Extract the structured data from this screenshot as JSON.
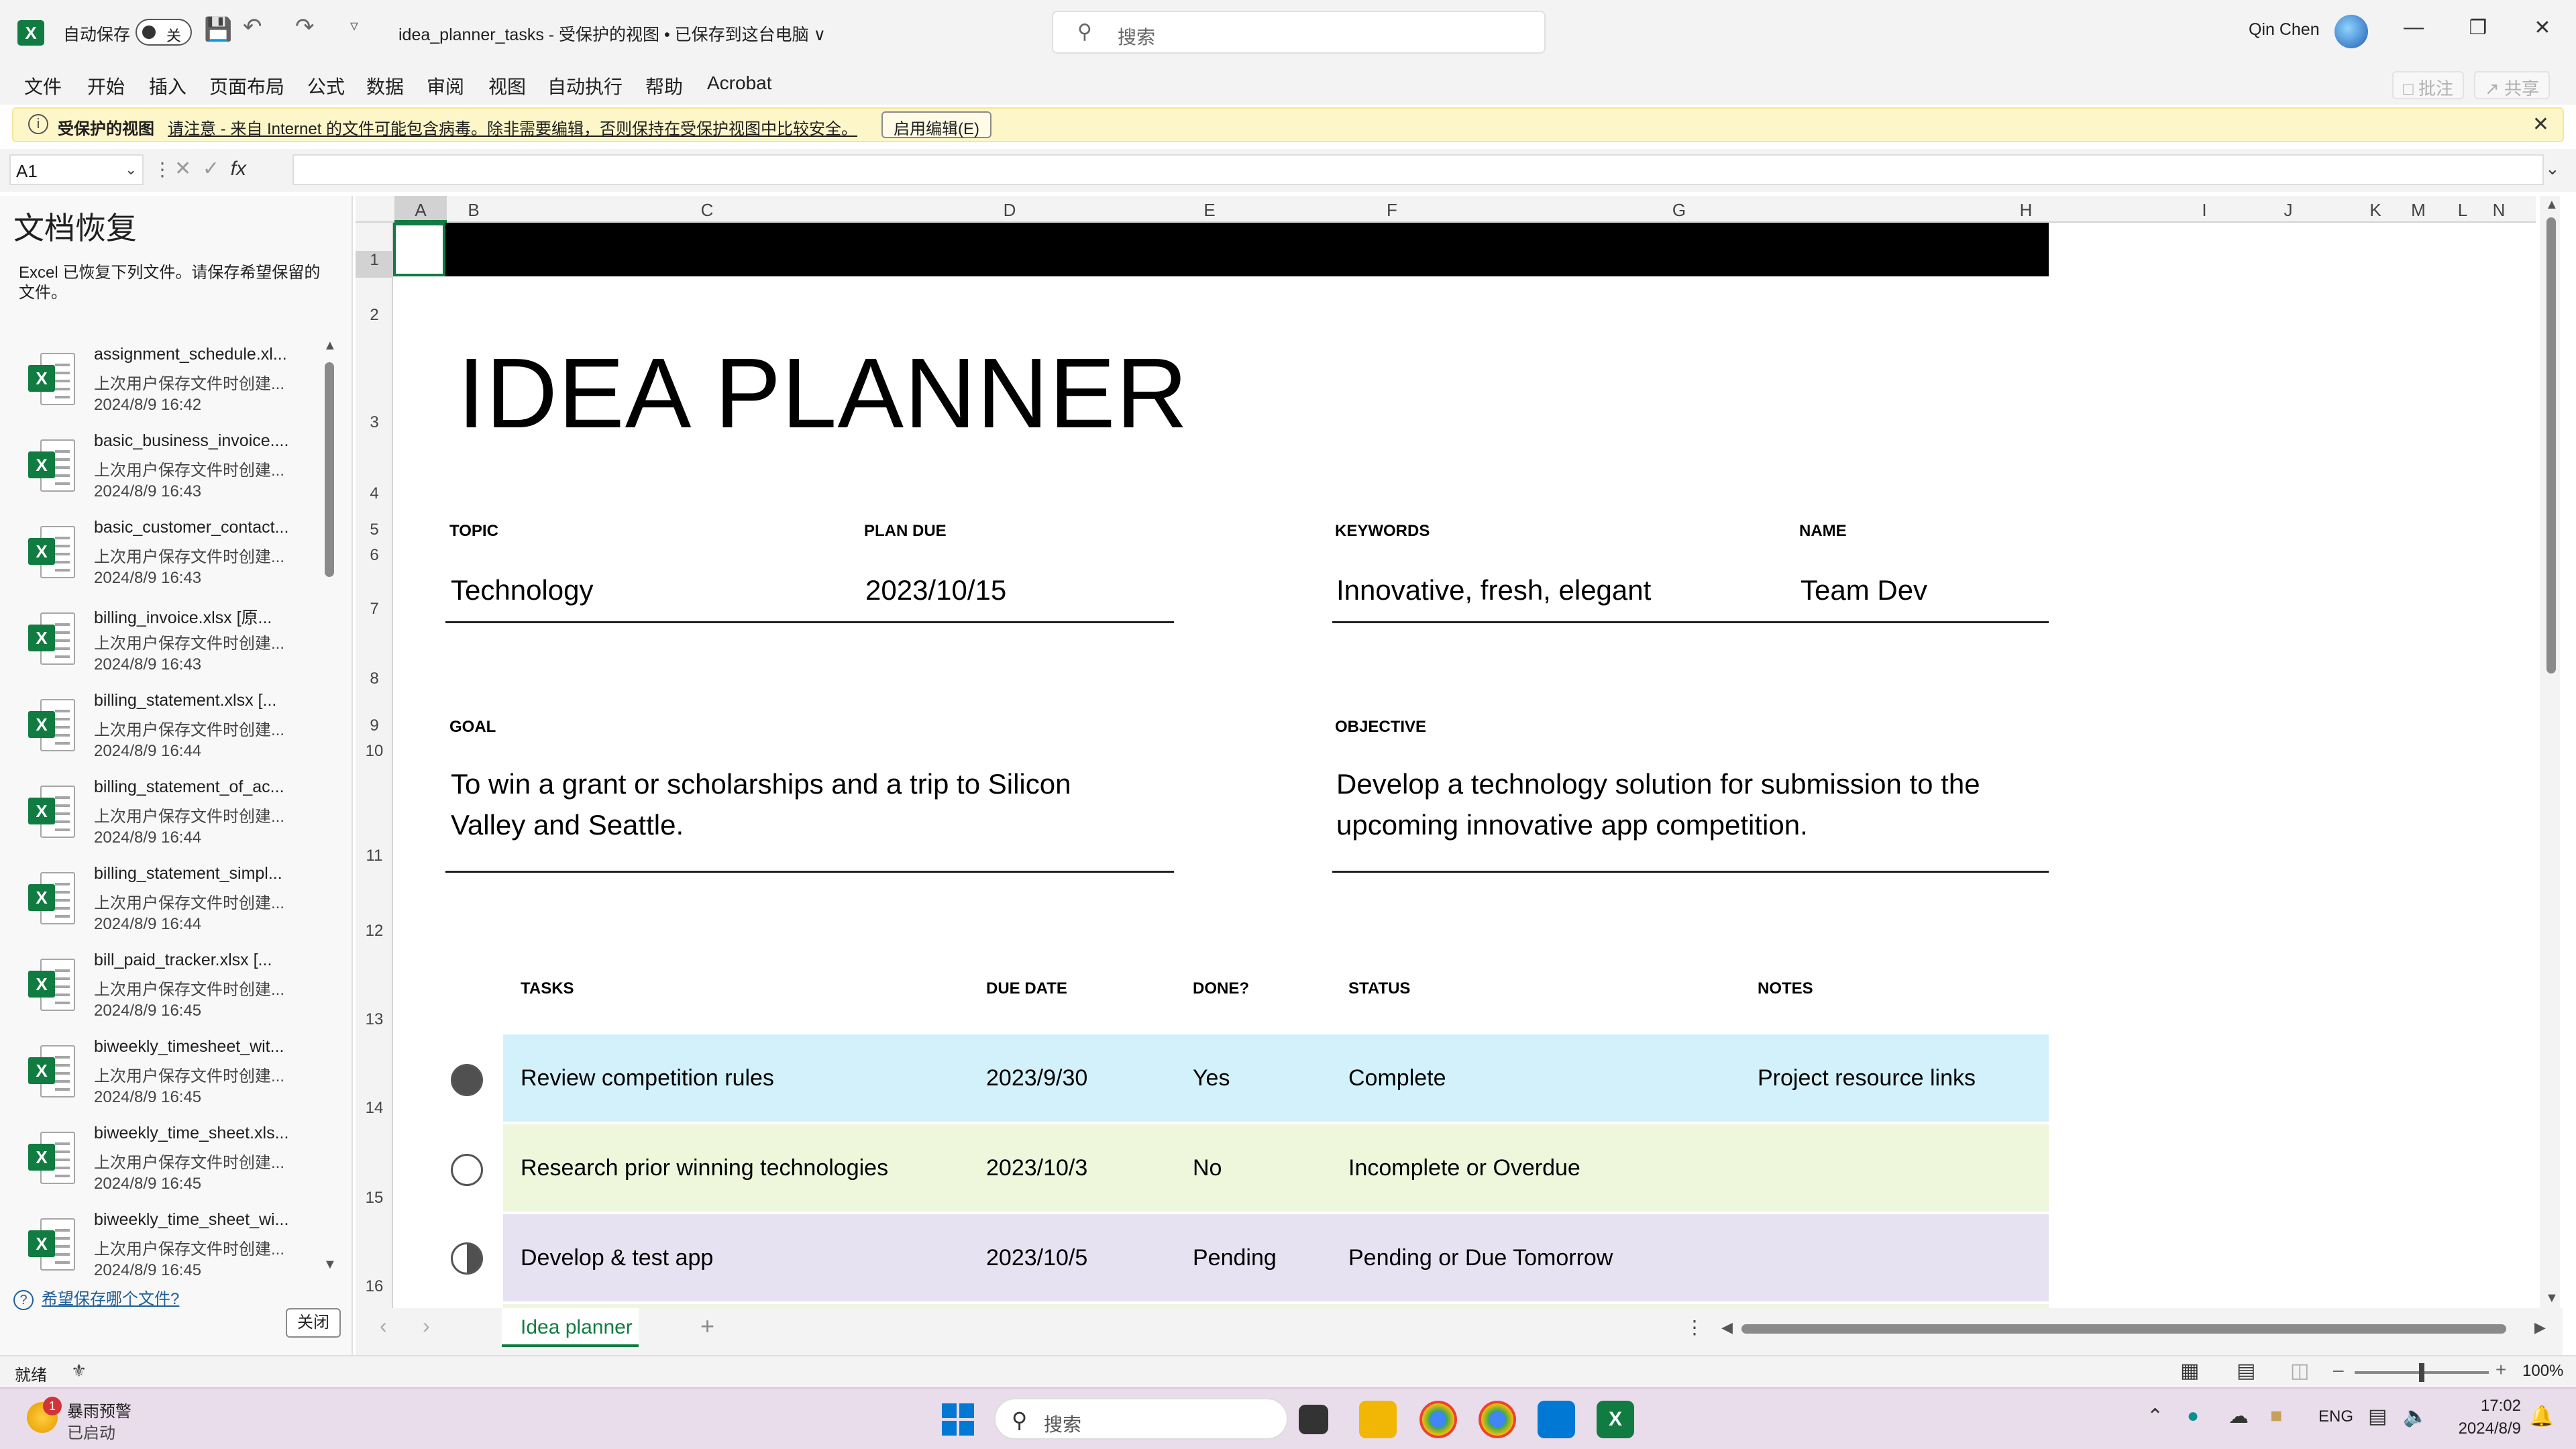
{
  "titlebar": {
    "app_icon": "X",
    "autosave_label": "自动保存",
    "autosave_state": "关",
    "doc_title": "idea_planner_tasks  -  受保护的视图 • 已保存到这台电脑 ∨",
    "search_placeholder": "搜索",
    "user_name": "Qin Chen"
  },
  "menu": {
    "items": [
      "文件",
      "开始",
      "插入",
      "页面布局",
      "公式",
      "数据",
      "审阅",
      "视图",
      "自动执行",
      "帮助",
      "Acrobat"
    ],
    "comment": "批注",
    "share": "共享"
  },
  "protected_view": {
    "title": "受保护的视图",
    "message": "请注意 - 来自 Internet 的文件可能包含病毒。除非需要编辑，否则保持在受保护视图中比较安全。",
    "enable_button": "启用编辑(E)"
  },
  "formula_bar": {
    "name_box": "A1",
    "fx": "fx",
    "value": ""
  },
  "recovery": {
    "title": "文档恢复",
    "description": "Excel 已恢复下列文件。请保存希望保留的文件。",
    "files": [
      {
        "name": "assignment_schedule.xl...",
        "status": "上次用户保存文件时创建...",
        "time": "2024/8/9 16:42"
      },
      {
        "name": "basic_business_invoice....",
        "status": "上次用户保存文件时创建...",
        "time": "2024/8/9 16:43"
      },
      {
        "name": "basic_customer_contact...",
        "status": "上次用户保存文件时创建...",
        "time": "2024/8/9 16:43"
      },
      {
        "name": "billing_invoice.xlsx  [原...",
        "status": "上次用户保存文件时创建...",
        "time": "2024/8/9 16:43"
      },
      {
        "name": "billing_statement.xlsx  [...",
        "status": "上次用户保存文件时创建...",
        "time": "2024/8/9 16:44"
      },
      {
        "name": "billing_statement_of_ac...",
        "status": "上次用户保存文件时创建...",
        "time": "2024/8/9 16:44"
      },
      {
        "name": "billing_statement_simpl...",
        "status": "上次用户保存文件时创建...",
        "time": "2024/8/9 16:44"
      },
      {
        "name": "bill_paid_tracker.xlsx  [...",
        "status": "上次用户保存文件时创建...",
        "time": "2024/8/9 16:45"
      },
      {
        "name": "biweekly_timesheet_wit...",
        "status": "上次用户保存文件时创建...",
        "time": "2024/8/9 16:45"
      },
      {
        "name": "biweekly_time_sheet.xls...",
        "status": "上次用户保存文件时创建...",
        "time": "2024/8/9 16:45"
      },
      {
        "name": "biweekly_time_sheet_wi...",
        "status": "上次用户保存文件时创建...",
        "time": "2024/8/9 16:45"
      }
    ],
    "help_link": "希望保存哪个文件?",
    "close_button": "关闭"
  },
  "grid": {
    "columns": [
      "A",
      "B",
      "C",
      "D",
      "E",
      "F",
      "G",
      "H",
      "I",
      "J",
      "K",
      "L",
      "M",
      "N"
    ],
    "rows": [
      "1",
      "2",
      "3",
      "4",
      "5",
      "6",
      "7",
      "8",
      "9",
      "10",
      "11",
      "12",
      "13",
      "14",
      "15",
      "16"
    ]
  },
  "planner": {
    "title": "IDEA PLANNER",
    "topic_label": "TOPIC",
    "topic": "Technology",
    "plan_due_label": "PLAN DUE",
    "plan_due": "2023/10/15",
    "keywords_label": "KEYWORDS",
    "keywords": "Innovative, fresh, elegant",
    "name_label": "NAME",
    "name": "Team Dev",
    "goal_label": "GOAL",
    "goal_line1": "To win a grant or scholarships and a trip to Silicon",
    "goal_line2": "Valley and Seattle.",
    "objective_label": "OBJECTIVE",
    "objective_line1": "Develop a technology solution for submission to the",
    "objective_line2": "upcoming innovative app competition.",
    "table_headers": {
      "tasks": "TASKS",
      "due": "DUE DATE",
      "done": "DONE?",
      "status": "STATUS",
      "notes": "NOTES"
    },
    "tasks": [
      {
        "task": "Review competition rules",
        "due": "2023/9/30",
        "done": "Yes",
        "status": "Complete",
        "notes": "Project resource links",
        "marker": "filled",
        "bg": "#d3f1fb"
      },
      {
        "task": "Research prior winning technologies",
        "due": "2023/10/3",
        "done": "No",
        "status": "Incomplete or Overdue",
        "notes": "",
        "marker": "empty",
        "bg": "#eef6dc"
      },
      {
        "task": "Develop & test app",
        "due": "2023/10/5",
        "done": "Pending",
        "status": "Pending or Due Tomorrow",
        "notes": "",
        "marker": "half",
        "bg": "#e6e2f1"
      }
    ]
  },
  "sheet_tabs": {
    "active": "Idea planner"
  },
  "status": {
    "ready": "就绪",
    "zoom": "100%"
  },
  "taskbar": {
    "weather_badge": "1",
    "weather_title": "暴雨预警",
    "weather_sub": "已启动",
    "search_placeholder": "搜索",
    "lang": "ENG",
    "time": "17:02",
    "date": "2024/8/9"
  },
  "colors": {
    "excel_green": "#107c41",
    "row_complete": "#d3f1fb",
    "row_incomplete": "#eef6dc",
    "row_pending": "#e6e2f1"
  }
}
